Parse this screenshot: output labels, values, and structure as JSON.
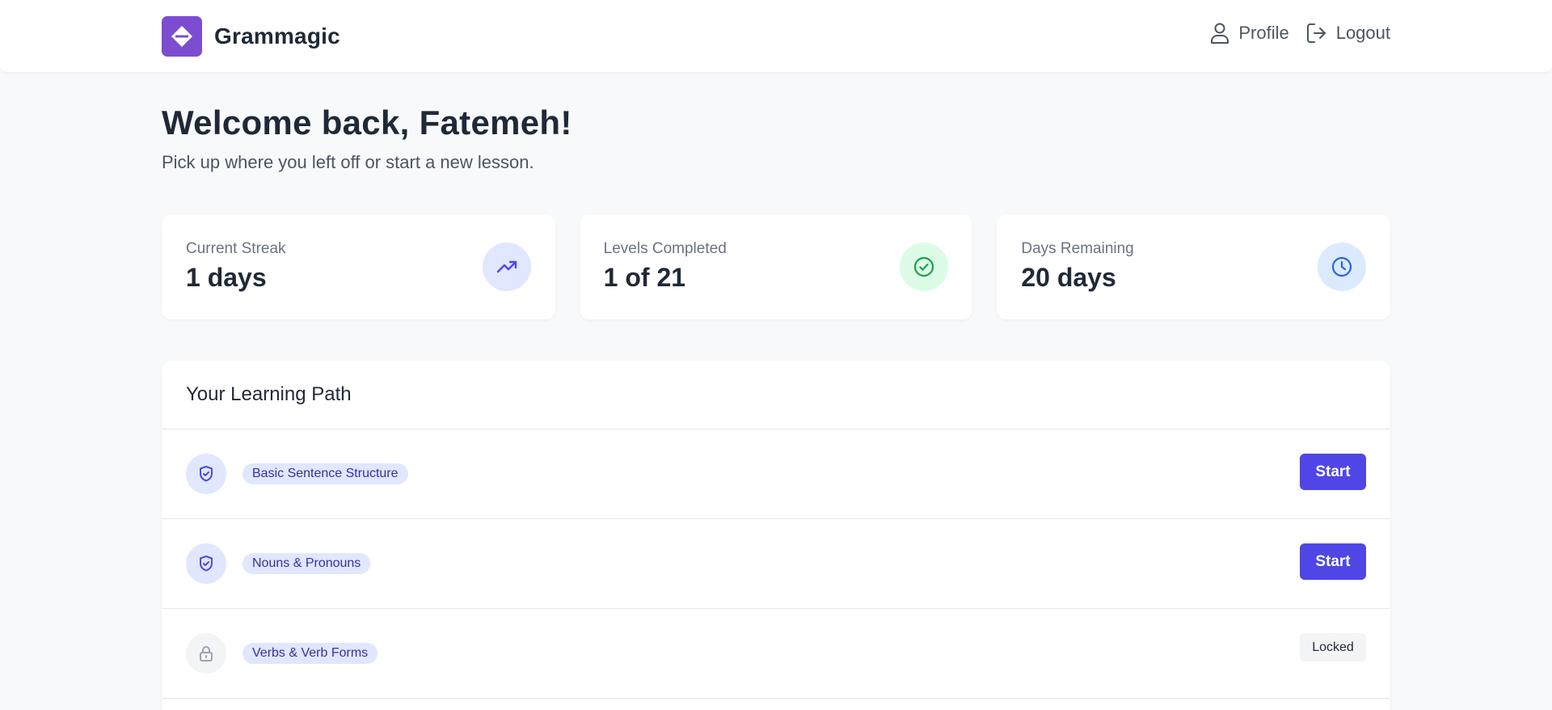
{
  "header": {
    "brand": "Grammagic",
    "nav": [
      {
        "label": "Profile",
        "icon": "user-icon"
      },
      {
        "label": "Logout",
        "icon": "logout-icon"
      }
    ]
  },
  "welcome": {
    "title": "Welcome back, Fatemeh!",
    "subtitle": "Pick up where you left off or start a new lesson."
  },
  "stats": [
    {
      "label": "Current Streak",
      "value": "1 days",
      "icon": "trending-up-icon",
      "icon_color": "#4f46e5",
      "icon_bg": "#e0e7ff"
    },
    {
      "label": "Levels Completed",
      "value": "1 of 21",
      "icon": "check-circle-icon",
      "icon_color": "#16a34a",
      "icon_bg": "#dcfce7"
    },
    {
      "label": "Days Remaining",
      "value": "20 days",
      "icon": "clock-icon",
      "icon_color": "#2563eb",
      "icon_bg": "#dbeafe"
    }
  ],
  "learning_path": {
    "title": "Your Learning Path",
    "lessons": [
      {
        "label": "Basic Sentence Structure",
        "status": "available",
        "action": "Start",
        "icon": "shield-check-icon"
      },
      {
        "label": "Nouns & Pronouns",
        "status": "available",
        "action": "Start",
        "icon": "shield-check-icon"
      },
      {
        "label": "Verbs & Verb Forms",
        "status": "locked",
        "action": "Locked",
        "icon": "lock-icon"
      }
    ]
  },
  "colors": {
    "accent": "#4f46e5",
    "brand": "#7c4dd0",
    "background": "#f8f9fb"
  }
}
